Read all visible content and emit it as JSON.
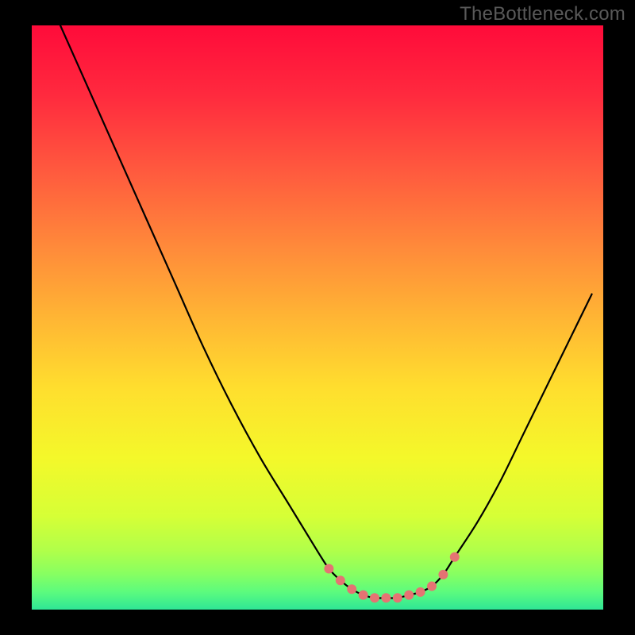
{
  "watermark": "TheBottleneck.com",
  "chart_data": {
    "type": "line",
    "title": "",
    "xlabel": "",
    "ylabel": "",
    "xlim": [
      0,
      100
    ],
    "ylim": [
      0,
      100
    ],
    "x": [
      5,
      10,
      15,
      20,
      25,
      30,
      35,
      40,
      45,
      50,
      52,
      54,
      56,
      58,
      60,
      62,
      64,
      66,
      68,
      70,
      72,
      74,
      78,
      82,
      86,
      90,
      94,
      98
    ],
    "values": [
      100,
      89,
      78,
      67,
      56,
      45,
      35,
      26,
      18,
      10,
      7,
      5,
      3.5,
      2.5,
      2,
      2,
      2,
      2.5,
      3,
      4,
      6,
      9,
      15,
      22,
      30,
      38,
      46,
      54
    ],
    "marker_points": {
      "x": [
        52,
        54,
        56,
        58,
        60,
        62,
        64,
        66,
        68,
        70,
        72,
        74
      ],
      "values": [
        7,
        5,
        3.5,
        2.5,
        2,
        2,
        2,
        2.5,
        3,
        4,
        6,
        9
      ]
    },
    "background": {
      "type": "vertical-gradient",
      "stops": [
        {
          "offset": 0.0,
          "color": "#ff0b3a"
        },
        {
          "offset": 0.12,
          "color": "#ff2a3e"
        },
        {
          "offset": 0.25,
          "color": "#ff5a3e"
        },
        {
          "offset": 0.38,
          "color": "#ff8a3a"
        },
        {
          "offset": 0.5,
          "color": "#ffb534"
        },
        {
          "offset": 0.62,
          "color": "#ffde2e"
        },
        {
          "offset": 0.74,
          "color": "#f4f82a"
        },
        {
          "offset": 0.84,
          "color": "#d6ff36"
        },
        {
          "offset": 0.9,
          "color": "#b0ff4a"
        },
        {
          "offset": 0.94,
          "color": "#86ff62"
        },
        {
          "offset": 0.97,
          "color": "#5bfb7e"
        },
        {
          "offset": 1.0,
          "color": "#2fe696"
        }
      ]
    },
    "curve_color": "#000000",
    "marker_color": "#e57373"
  }
}
